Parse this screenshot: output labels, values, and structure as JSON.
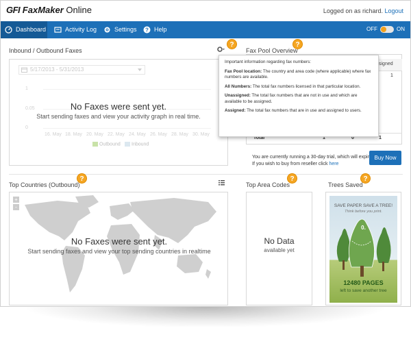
{
  "app": {
    "logo_gfi": "GFI",
    "logo_faxmaker": "FaxMaker",
    "logo_online": " Online",
    "logged_in_text": "Logged on as richard.",
    "logout_label": "Logout"
  },
  "nav": {
    "items": [
      {
        "label": "Dashboard",
        "icon": "dashboard-icon",
        "active": true
      },
      {
        "label": "Activity Log",
        "icon": "activity-log-icon",
        "active": false
      },
      {
        "label": "Settings",
        "icon": "settings-icon",
        "active": false
      },
      {
        "label": "Help",
        "icon": "help-icon",
        "active": false
      }
    ],
    "toggle_off": "OFF",
    "toggle_on": "ON"
  },
  "inbound_outbound": {
    "title": "Inbound / Outbound Faxes",
    "date_range": "5/17/2013 - 5/31/2013",
    "y_ticks": [
      "1",
      "0.05",
      "0"
    ],
    "x_ticks": [
      "16. May",
      "18. May",
      "20. May",
      "22. May",
      "24. May",
      "26. May",
      "28. May",
      "30. May"
    ],
    "legend_outbound": "Outbound",
    "legend_inbound": "Inbound",
    "empty_title": "No Faxes were sent yet.",
    "empty_sub": "Start sending faxes and view your activity graph in real time."
  },
  "fax_pool": {
    "title": "Fax Pool Overview",
    "header_partial": "signed",
    "row_values": [
      "1"
    ],
    "total_label": "Total",
    "total_values": [
      "1",
      "0",
      "1"
    ],
    "trial_text": "You are currently running a 30-day trial, which will expire on",
    "reseller_text": "If you wish to buy from reseller click",
    "reseller_link": "here",
    "buy_now": "Buy Now"
  },
  "tooltip": {
    "intro": "Important information regarding fax numbers:",
    "items": [
      {
        "term": "Fax Pool location:",
        "desc": " The country and area code (where applicable) where fax numbers are available."
      },
      {
        "term": "All Numbers:",
        "desc": " The total fax numbers licensed in that particular location."
      },
      {
        "term": "Unassigned:",
        "desc": " The total fax numbers that are not in use and which are available to be assigned."
      },
      {
        "term": "Assigned:",
        "desc": " The total fax numbers that are in use and assigned to users."
      }
    ]
  },
  "top_countries": {
    "title": "Top Countries (Outbound)",
    "zoom_in": "+",
    "zoom_out": "-",
    "empty_title": "No Faxes were sent yet.",
    "empty_sub": "Start sending faxes and view your top sending countries in realtime"
  },
  "top_area_codes": {
    "title": "Top Area Codes",
    "empty_title": "No Data",
    "empty_sub": "available yet"
  },
  "trees_saved": {
    "title": "Trees Saved",
    "headline": "SAVE PAPER SAVE A TREE!",
    "tagline": "Think before you print.",
    "counter": "0.",
    "pages": "12480 PAGES",
    "pages_sub": "left to save another tree"
  },
  "help_badge": "?",
  "colors": {
    "nav": "#1d70b8",
    "accent": "#f5a623",
    "link": "#1a6fb8"
  }
}
